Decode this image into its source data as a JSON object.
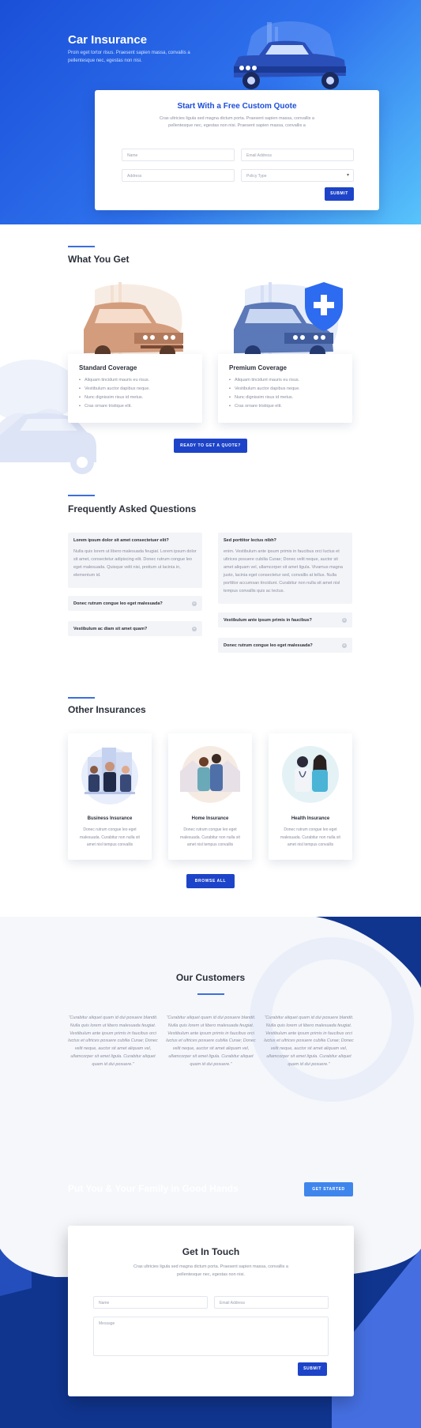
{
  "hero": {
    "title": "Car Insurance",
    "subtitle": "Proin eget tortor risus. Praesent sapien massa, convallis a pellentesque nec, egestas non nisi."
  },
  "quote_form": {
    "title": "Start With a Free Custom Quote",
    "subtitle": "Cras ultricies ligula sed magna dictum porta. Praesent sapien massa, convallis a pellentesque nec, egestas non nisi. Praesent sapien massa, convallis a",
    "name_placeholder": "Name",
    "email_placeholder": "Email Address",
    "address_placeholder": "Address",
    "policy_selected": "Policy Type",
    "submit_label": "SUBMIT"
  },
  "what_you_get": {
    "title": "What You Get",
    "plans": [
      {
        "title": "Standard Coverage",
        "items": [
          "Aliquam tincidunt mauris eu risus.",
          "Vestibulum auctor dapibus neque.",
          "Nunc dignissim risus id metus.",
          "Cras ornare tristique elit."
        ]
      },
      {
        "title": "Premium Coverage",
        "items": [
          "Aliquam tincidunt mauris eu risus.",
          "Vestibulum auctor dapibus neque.",
          "Nunc dignissim risus id metus.",
          "Cras ornare tristique elit."
        ]
      }
    ],
    "cta_label": "READY TO GET A QUOTE?"
  },
  "faq": {
    "title": "Frequently Asked Questions",
    "left": [
      {
        "q": "Lorem ipsum dolor sit amet consectetuer elit?",
        "a": "Nulla quis lorem ut libero malesuada feugiat. Lorem ipsum dolor sit amet, consectetur adipiscing elit. Donec rutrum congue leo eget malesuada. Quisque velit nisi, pretium ut lacinia in, elementum id."
      },
      {
        "q": "Donec rutrum congue leo eget malesuada?"
      },
      {
        "q": "Vestibulum ac diam sit amet quam?"
      }
    ],
    "right": [
      {
        "q": "Sed porttitor lectus nibh?",
        "a": "enim. Vestibulum ante ipsum primis in faucibus orci luctus et ultrices posuere cubilia Curae; Donec velit neque, auctor sit amet aliquam vel, ullamcorper sit amet ligula. Vivamus magna justo, lacinia eget consectetur sed, convallis at tellus. Nulla porttitor accumsan tincidunt. Curabitur non nulla sit amet nisl tempus convallis quis ac lectus."
      },
      {
        "q": "Vestibulum ante ipsum primis in faucibus?"
      },
      {
        "q": "Donec rutrum congue leo eget malesuada?"
      }
    ]
  },
  "other_insurances": {
    "title": "Other Insurances",
    "cards": [
      {
        "title": "Business Insurance",
        "text": "Donec rutrum congue leo eget malesuada. Curabitur non nulla sit amet nisl tempus convallis"
      },
      {
        "title": "Home Insurance",
        "text": "Donec rutrum congue leo eget malesuada. Curabitur non nulla sit amet nisl tempus convallis"
      },
      {
        "title": "Health Insurance",
        "text": "Donec rutrum congue leo eget malesuada. Curabitur non nulla sit amet nisl tempus convallis"
      }
    ],
    "browse_label": "BROWSE ALL"
  },
  "customers": {
    "title": "Our Customers",
    "quotes": [
      "“Curabitur aliquet quam id dui posuere blandit. Nulla quis lorem ut libero malesuada feugiat. Vestibulum ante ipsum primis in faucibus orci luctus et ultrices posuere cubilia Curae; Donec velit neque, auctor sit amet aliquam vel, ullamcorper sit amet ligula. Curabitur aliquet quam id dui posuere.”",
      "“Curabitur aliquet quam id dui posuere blandit. Nulla quis lorem ut libero malesuada feugiat. Vestibulum ante ipsum primis in faucibus orci luctus et ultrices posuere cubilia Curae; Donec velit neque, auctor sit amet aliquam vel, ullamcorper sit amet ligula. Curabitur aliquet quam id dui posuere.”",
      "“Curabitur aliquet quam id dui posuere blandit. Nulla quis lorem ut libero malesuada feugiat. Vestibulum ante ipsum primis in faucibus orci luctus et ultrices posuere cubilia Curae; Donec velit neque, auctor sit amet aliquam vel, ullamcorper sit amet ligula. Curabitur aliquet quam id dui posuere.”"
    ]
  },
  "cta": {
    "title": "Put You & Your Family in Good Hands",
    "button_label": "GET STARTED"
  },
  "contact": {
    "title": "Get In Touch",
    "subtitle": "Cras ultricies ligula sed magna dictum porta. Praesent sapien massa, convallis a pellentesque nec, egestas non nisi.",
    "name_placeholder": "Name",
    "email_placeholder": "Email Address",
    "message_placeholder": "Message",
    "submit_label": "SUBMIT"
  },
  "colors": {
    "primary": "#1d44c8",
    "accent": "#3b6fe0",
    "dark_navy": "#10358f"
  }
}
